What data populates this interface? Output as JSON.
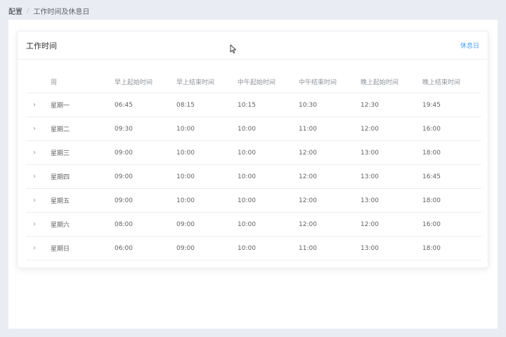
{
  "breadcrumb": {
    "root": "配置",
    "separator": "/",
    "current": "工作时间及休息日"
  },
  "card": {
    "title": "工作时间",
    "link": "休息日"
  },
  "table": {
    "headers": [
      "周",
      "早上起始时间",
      "早上结束时间",
      "中午起始时间",
      "中午结束时间",
      "晚上起始时间",
      "晚上结束时间"
    ],
    "rows": [
      {
        "day": "星期一",
        "m_start": "06:45",
        "m_end": "08:15",
        "n_start": "10:15",
        "n_end": "10:30",
        "e_start": "12:30",
        "e_end": "19:45"
      },
      {
        "day": "星期二",
        "m_start": "09:30",
        "m_end": "10:00",
        "n_start": "10:00",
        "n_end": "11:00",
        "e_start": "12:00",
        "e_end": "16:00"
      },
      {
        "day": "星期三",
        "m_start": "09:00",
        "m_end": "10:00",
        "n_start": "10:00",
        "n_end": "12:00",
        "e_start": "13:00",
        "e_end": "18:00"
      },
      {
        "day": "星期四",
        "m_start": "09:00",
        "m_end": "10:00",
        "n_start": "10:00",
        "n_end": "12:00",
        "e_start": "13:00",
        "e_end": "16:45"
      },
      {
        "day": "星期五",
        "m_start": "09:00",
        "m_end": "10:00",
        "n_start": "10:00",
        "n_end": "12:00",
        "e_start": "13:00",
        "e_end": "18:00"
      },
      {
        "day": "星期六",
        "m_start": "08:00",
        "m_end": "09:00",
        "n_start": "10:00",
        "n_end": "12:00",
        "e_start": "12:00",
        "e_end": "16:00"
      },
      {
        "day": "星期日",
        "m_start": "06:00",
        "m_end": "09:00",
        "n_start": "10:00",
        "n_end": "11:00",
        "e_start": "13:00",
        "e_end": "18:00"
      }
    ]
  },
  "icons": {
    "row_expand": "chevron-right-icon",
    "cursor": "mouse-pointer-icon"
  }
}
